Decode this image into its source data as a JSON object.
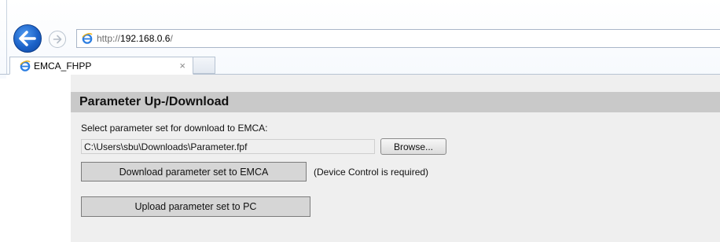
{
  "browser": {
    "address": {
      "prefix": "http://",
      "host": "192.168.0.6",
      "suffix": "/"
    },
    "tab": {
      "title": "EMCA_FHPP",
      "close_glyph": "×"
    },
    "icons": {
      "back": "back-arrow-icon",
      "forward": "forward-arrow-icon",
      "page": "ie-page-icon"
    },
    "colors": {
      "back_button": "#1b62c8"
    }
  },
  "panel": {
    "title": "Parameter Up-/Download",
    "select_label": "Select parameter set for download to EMCA:",
    "file_path": "C:\\Users\\sbu\\Downloads\\Parameter.fpf",
    "browse_label": "Browse...",
    "download_label": "Download parameter set to EMCA",
    "download_note": "(Device Control is required)",
    "upload_label": "Upload parameter set to PC",
    "colors": {
      "background": "#efefef",
      "header": "#c9c9c9",
      "button": "#d6d6d6"
    }
  }
}
